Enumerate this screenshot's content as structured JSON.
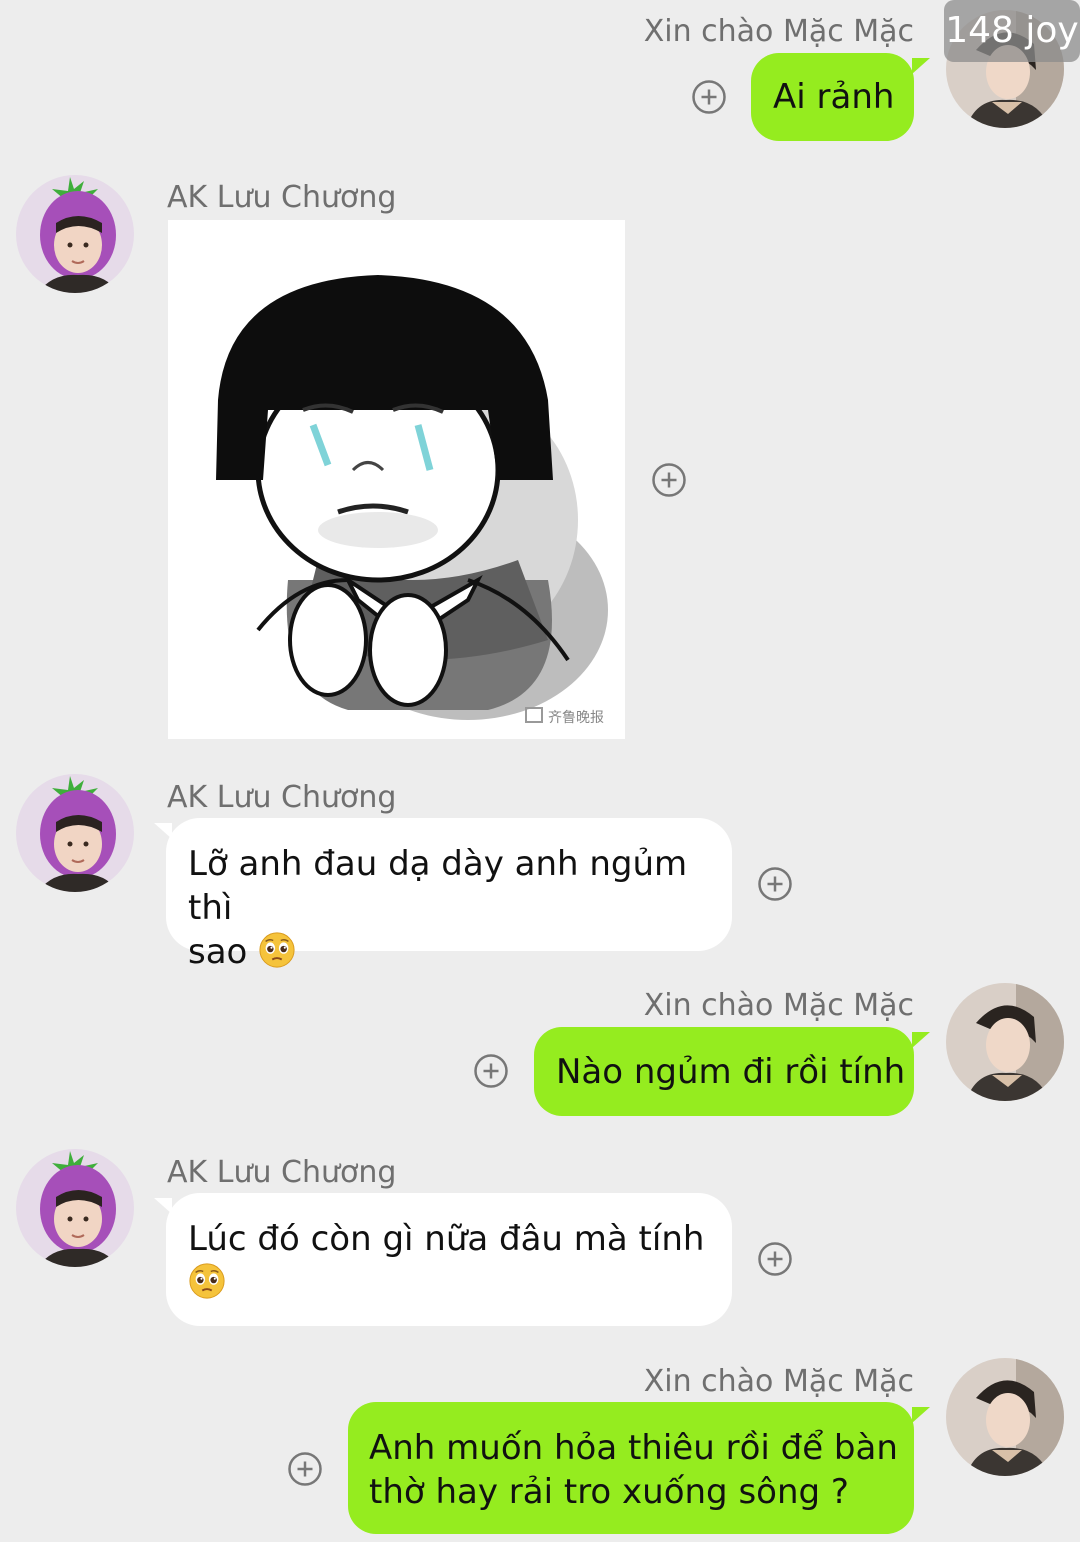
{
  "badge": "148 joy",
  "colors": {
    "background": "#ededed",
    "sent_bubble": "#95ec1f",
    "received_bubble": "#ffffff",
    "name_text": "#6f6f6f"
  },
  "messages": [
    {
      "sender": "Xin chào Mặc Mặc",
      "side": "right",
      "type": "text",
      "text": "Ai rảnh"
    },
    {
      "sender": "AK Lưu Chương",
      "side": "left",
      "type": "sticker",
      "sticker_icon": "crying-bowlcut-sticker",
      "watermark": "齐鲁晚报"
    },
    {
      "sender": "AK Lưu Chương",
      "side": "left",
      "type": "text",
      "line1": "Lỡ anh đau dạ dày anh ngủm thì",
      "line2": "sao",
      "emoji": "pleading-face-emoji"
    },
    {
      "sender": "Xin chào Mặc Mặc",
      "side": "right",
      "type": "text",
      "text": "Nào ngủm đi rồi tính"
    },
    {
      "sender": "AK Lưu Chương",
      "side": "left",
      "type": "text",
      "line1": "Lúc đó còn gì nữa đâu mà tính",
      "emoji": "pleading-face-emoji"
    },
    {
      "sender": "Xin chào Mặc Mặc",
      "side": "right",
      "type": "text",
      "line1": "Anh muốn hỏa thiêu rồi để bàn",
      "line2": "thờ hay rải tro xuống sông ?"
    }
  ]
}
